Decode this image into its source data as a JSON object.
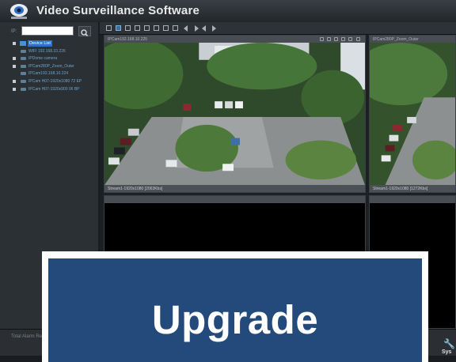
{
  "app": {
    "title": "Video Surveillance Software"
  },
  "sidebar": {
    "search_label": "IP:",
    "search_value": "",
    "tree": [
      {
        "label": "Device List",
        "root": true
      },
      {
        "label": "WIFI 192.168.10.226"
      },
      {
        "label": "IPDome camera"
      },
      {
        "label": "IPCam280P_Zoom_Outer"
      },
      {
        "label": "IPCam192.168.10.224"
      },
      {
        "label": "IPCam H07-1920x1080 72 EP"
      },
      {
        "label": "IPCam H07-1920x900 06 BP"
      }
    ]
  },
  "panes": [
    {
      "title": "IPCam192.168.10.225",
      "stream": "Stream1-1920x1080 [2063Kbs]"
    },
    {
      "title": "IPCam280P_Zoom_Outer",
      "stream": "Stream1-1920x1080 [1272Kbs]"
    }
  ],
  "status": {
    "text": "Total Alarm Records: 0"
  },
  "system_button": {
    "label": "Sys",
    "icon": "wrench-icon"
  },
  "overlay": {
    "text": "Upgrade"
  },
  "colors": {
    "overlay_bg": "#234a7b",
    "accent": "#2f6fc6"
  }
}
